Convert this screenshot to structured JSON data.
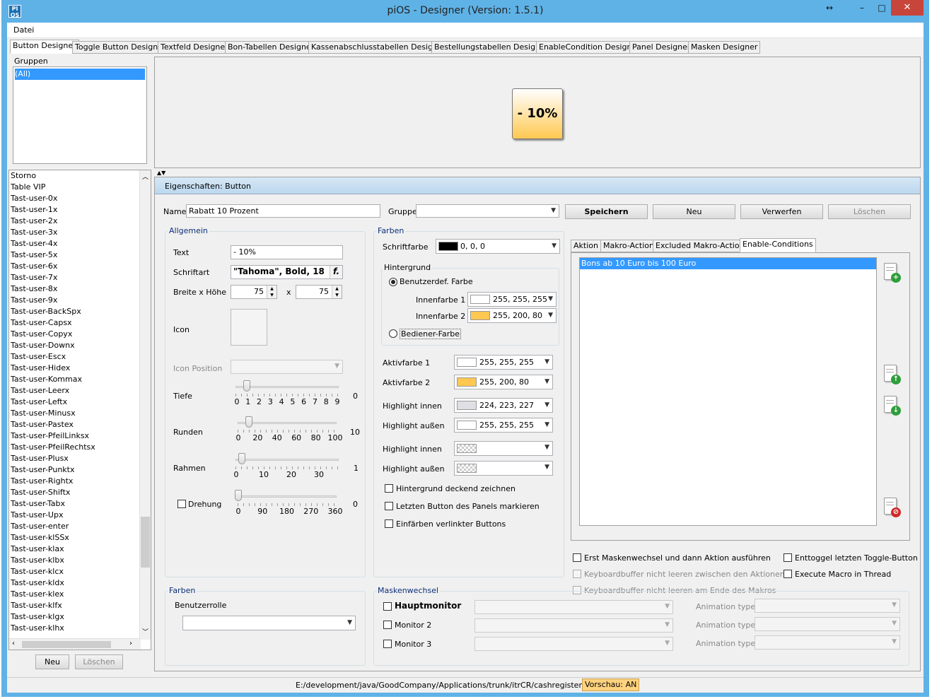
{
  "window": {
    "title": "piOS - Designer  (Version: 1.5.1)",
    "icon_text": "PI OS",
    "controls": {
      "restore": "↔",
      "minimize": "–",
      "maximize": "□",
      "close": "✕"
    }
  },
  "menu": {
    "datei": "Datei"
  },
  "tabs": [
    "Button Designer",
    "Toggle Button Designer",
    "Textfeld Designer",
    "Bon-Tabellen Designer",
    "Kassenabschlusstabellen Designer",
    "Bestellungstabellen Designer",
    "EnableCondition Designer",
    "Panel Designer",
    "Masken Designer"
  ],
  "groups": {
    "label": "Gruppen",
    "items": [
      "(All)"
    ]
  },
  "button_list": [
    "Storno",
    "Table VIP",
    "Tast-user-0x",
    "Tast-user-1x",
    "Tast-user-2x",
    "Tast-user-3x",
    "Tast-user-4x",
    "Tast-user-5x",
    "Tast-user-6x",
    "Tast-user-7x",
    "Tast-user-8x",
    "Tast-user-9x",
    "Tast-user-BackSpx",
    "Tast-user-Capsx",
    "Tast-user-Copyx",
    "Tast-user-Downx",
    "Tast-user-Escx",
    "Tast-user-Hidex",
    "Tast-user-Kommax",
    "Tast-user-Leerx",
    "Tast-user-Leftx",
    "Tast-user-Minusx",
    "Tast-user-Pastex",
    "Tast-user-PfeilLinksx",
    "Tast-user-PfeilRechtsx",
    "Tast-user-Plusx",
    "Tast-user-Punktx",
    "Tast-user-Rightx",
    "Tast-user-Shiftx",
    "Tast-user-Tabx",
    "Tast-user-Upx",
    "Tast-user-enter",
    "Tast-user-klSSx",
    "Tast-user-klax",
    "Tast-user-klbx",
    "Tast-user-klcx",
    "Tast-user-kldx",
    "Tast-user-klex",
    "Tast-user-klfx",
    "Tast-user-klgx",
    "Tast-user-klhx"
  ],
  "left_buttons": {
    "neu": "Neu",
    "loeschen": "Löschen"
  },
  "preview": {
    "button_text": "- 10%"
  },
  "properties": {
    "header": "Eigenschaften: Button",
    "name_label": "Name",
    "name_value": "Rabatt 10 Prozent",
    "gruppe_label": "Gruppe",
    "gruppe_value": "",
    "speichern": "Speichern",
    "neu": "Neu",
    "verwerfen": "Verwerfen",
    "loeschen": "Löschen"
  },
  "allgemein": {
    "label": "Allgemein",
    "text_label": "Text",
    "text_value": "- 10%",
    "schriftart_label": "Schriftart",
    "schriftart_value": "\"Tahoma\", Bold, 18",
    "font_btn": "f.",
    "breite_label": "Breite x Höhe",
    "breite": "75",
    "x": "x",
    "hoehe": "75",
    "icon_label": "Icon",
    "icon_position_label": "Icon Position",
    "tiefe_label": "Tiefe",
    "tiefe_value": "0",
    "tiefe_ticks": [
      "0",
      "1",
      "2",
      "3",
      "4",
      "5",
      "6",
      "7",
      "8",
      "9"
    ],
    "runden_label": "Runden",
    "runden_value": "10",
    "runden_ticks": [
      "0",
      "20",
      "40",
      "60",
      "80",
      "100"
    ],
    "rahmen_label": "Rahmen",
    "rahmen_value": "1",
    "rahmen_ticks": [
      "0",
      "10",
      "20",
      "30"
    ],
    "drehung_label": "Drehung",
    "drehung_value": "0",
    "drehung_ticks": [
      "0",
      "90",
      "180",
      "270",
      "360"
    ]
  },
  "farben": {
    "label": "Farben",
    "schriftfarbe_label": "Schriftfarbe",
    "schriftfarbe_value": "0, 0, 0",
    "schriftfarbe_color": "#000000",
    "hintergrund_label": "Hintergrund",
    "benutzerdef_label": "Benutzerdef. Farbe",
    "innenfarbe1_label": "Innenfarbe 1",
    "innenfarbe1_value": "255, 255, 255",
    "innenfarbe1_color": "#ffffff",
    "innenfarbe2_label": "Innenfarbe 2",
    "innenfarbe2_value": "255, 200, 80",
    "innenfarbe2_color": "#ffc850",
    "bediener_label": "Bediener-Farbe",
    "aktivfarbe1_label": "Aktivfarbe 1",
    "aktivfarbe1_value": "255, 255, 255",
    "aktivfarbe1_color": "#ffffff",
    "aktivfarbe2_label": "Aktivfarbe 2",
    "aktivfarbe2_value": "255, 200, 80",
    "aktivfarbe2_color": "#ffc850",
    "highlight_innen1_label": "Highlight innen",
    "highlight_innen1_value": "224, 223, 227",
    "highlight_innen1_color": "#e0dfe3",
    "highlight_aussen1_label": "Highlight außen",
    "highlight_aussen1_value": "255, 255, 255",
    "highlight_aussen1_color": "#ffffff",
    "highlight_innen2_label": "Highlight innen",
    "highlight_aussen2_label": "Highlight außen",
    "cb1": "Hintergrund deckend zeichnen",
    "cb2": "Letzten Button des Panels markieren",
    "cb3": "Einfärben verlinkter Buttons"
  },
  "action_tabs": [
    "Aktion",
    "Makro-Action",
    "Excluded Makro-Actions",
    "Enable-Conditions"
  ],
  "conditions": [
    "Bons ab 10 Euro bis 100 Euro"
  ],
  "options": {
    "erst": "Erst Maskenwechsel und dann Aktion ausführen",
    "kb1": "Keyboardbuffer nicht leeren zwischen den Aktionen",
    "kb2": "Keyboardbuffer nicht leeren am Ende des Makros",
    "enttoggel": "Enttoggel letzten Toggle-Button",
    "execute": "Execute Macro in Thread"
  },
  "farben2": {
    "label": "Farben",
    "benutzerrolle": "Benutzerrolle"
  },
  "maskenwechsel": {
    "label": "Maskenwechsel",
    "hauptmonitor": "Hauptmonitor",
    "monitor2": "Monitor 2",
    "monitor3": "Monitor 3",
    "animation": "Animation type"
  },
  "status": {
    "path": "E:/development/java/GoodCompany/Applications/trunk/itrCR/cashregister",
    "vorschau": "Vorschau: AN"
  },
  "colors": {
    "accent": "#5fb2e6",
    "selection": "#3399ff",
    "preview_btn": "#ffc850",
    "vorschau_bg": "#ffd27f"
  }
}
